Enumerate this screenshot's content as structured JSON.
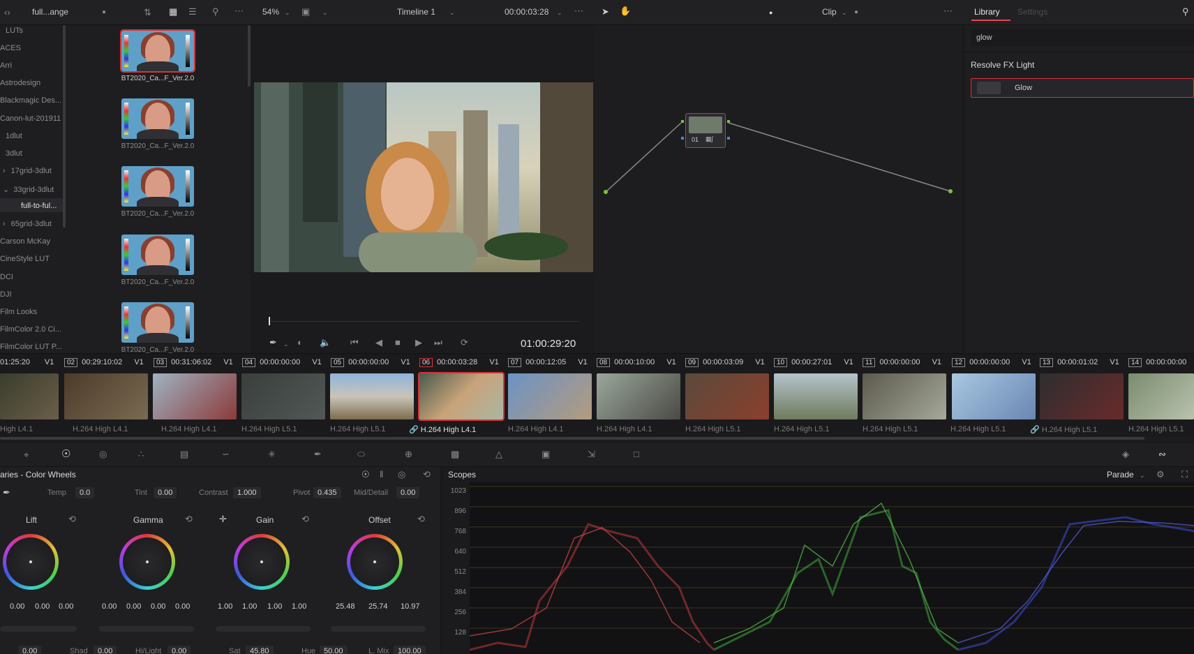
{
  "topbar": {
    "media_pool_name": "full...ange",
    "zoom": "54%",
    "timeline_name": "Timeline 1",
    "timecode": "00:00:03:28",
    "clip_mode": "Clip",
    "tab_library": "Library",
    "tab_settings": "Settings"
  },
  "lut_tree": [
    "LUTs",
    "ACES",
    "Arri",
    "Astrodesign",
    "Blackmagic Des...",
    "Canon-lut-201911",
    "1dlut",
    "3dlut",
    "17grid-3dlut",
    "33grid-3dlut",
    "full-to-ful...",
    "65grid-3dlut",
    "Carson McKay",
    "CineStyle LUT",
    "DCI",
    "DJI",
    "Film Looks",
    "FilmColor 2.0 Ci...",
    "FilmColor LUT P..."
  ],
  "lut_thumbs": [
    "BT2020_Ca...F_Ver.2.0",
    "BT2020_Ca...F_Ver.2.0",
    "BT2020_Ca...F_Ver.2.0",
    "BT2020_Ca...F_Ver.2.0",
    "BT2020_Ca...F_Ver.2.0"
  ],
  "viewer": {
    "timecode": "01:00:29:20"
  },
  "node": {
    "label": "01"
  },
  "library": {
    "search_value": "glow",
    "section": "Resolve FX Light",
    "effect": "Glow"
  },
  "clips": [
    {
      "num": "",
      "tc": "01:25:20",
      "track": "V1",
      "codec": "High L4.1"
    },
    {
      "num": "02",
      "tc": "00:29:10:02",
      "track": "V1",
      "codec": "H.264 High L4.1"
    },
    {
      "num": "03",
      "tc": "00:31:06:02",
      "track": "V1",
      "codec": "H.264 High L4.1"
    },
    {
      "num": "04",
      "tc": "00:00:00:00",
      "track": "V1",
      "codec": "H.264 High L5.1"
    },
    {
      "num": "05",
      "tc": "00:00:00:00",
      "track": "V1",
      "codec": "H.264 High L5.1"
    },
    {
      "num": "06",
      "tc": "00:00:03:28",
      "track": "V1",
      "codec": "H.264 High L4.1"
    },
    {
      "num": "07",
      "tc": "00:00:12:05",
      "track": "V1",
      "codec": "H.264 High L4.1"
    },
    {
      "num": "08",
      "tc": "00:00:10:00",
      "track": "V1",
      "codec": "H.264 High L4.1"
    },
    {
      "num": "09",
      "tc": "00:00:03:09",
      "track": "V1",
      "codec": "H.264 High L5.1"
    },
    {
      "num": "10",
      "tc": "00:00:27:01",
      "track": "V1",
      "codec": "H.264 High L5.1"
    },
    {
      "num": "11",
      "tc": "00:00:00:00",
      "track": "V1",
      "codec": "H.264 High L5.1"
    },
    {
      "num": "12",
      "tc": "00:00:00:00",
      "track": "V1",
      "codec": "H.264 High L5.1"
    },
    {
      "num": "13",
      "tc": "00:00:01:02",
      "track": "V1",
      "codec": "H.264 High L5.1"
    },
    {
      "num": "14",
      "tc": "00:00:00:00",
      "track": "",
      "codec": "H.264 High L5.1"
    }
  ],
  "wheels_panel": {
    "title": "aries - Color Wheels",
    "temp_label": "Temp",
    "temp": "0.0",
    "tint_label": "Tint",
    "tint": "0.00",
    "contrast_label": "Contrast",
    "contrast": "1.000",
    "pivot_label": "Pivot",
    "pivot": "0.435",
    "middetail_label": "Mid/Detail",
    "middetail": "0.00",
    "wheels": [
      {
        "name": "Lift",
        "values": [
          "0.00",
          "0.00",
          "0.00",
          "0.00"
        ]
      },
      {
        "name": "Gamma",
        "values": [
          "0.00",
          "0.00",
          "0.00",
          "0.00"
        ]
      },
      {
        "name": "Gain",
        "values": [
          "1.00",
          "1.00",
          "1.00",
          "1.00"
        ]
      },
      {
        "name": "Offset",
        "values": [
          "25.48",
          "25.74",
          "10.97"
        ]
      }
    ],
    "bottom": [
      {
        "label": "",
        "value": "0.00"
      },
      {
        "label": "Shad",
        "value": "0.00"
      },
      {
        "label": "Hi/Light",
        "value": "0.00"
      },
      {
        "label": "Sat",
        "value": "45.80"
      },
      {
        "label": "Hue",
        "value": "50.00"
      },
      {
        "label": "L. Mix",
        "value": "100.00"
      }
    ]
  },
  "scopes": {
    "title": "Scopes",
    "mode": "Parade",
    "ticks": [
      "1023",
      "896",
      "768",
      "640",
      "512",
      "384",
      "256",
      "128"
    ]
  },
  "colors": {
    "accent_red": "#d4343a",
    "library_tab": "#e0484e"
  }
}
